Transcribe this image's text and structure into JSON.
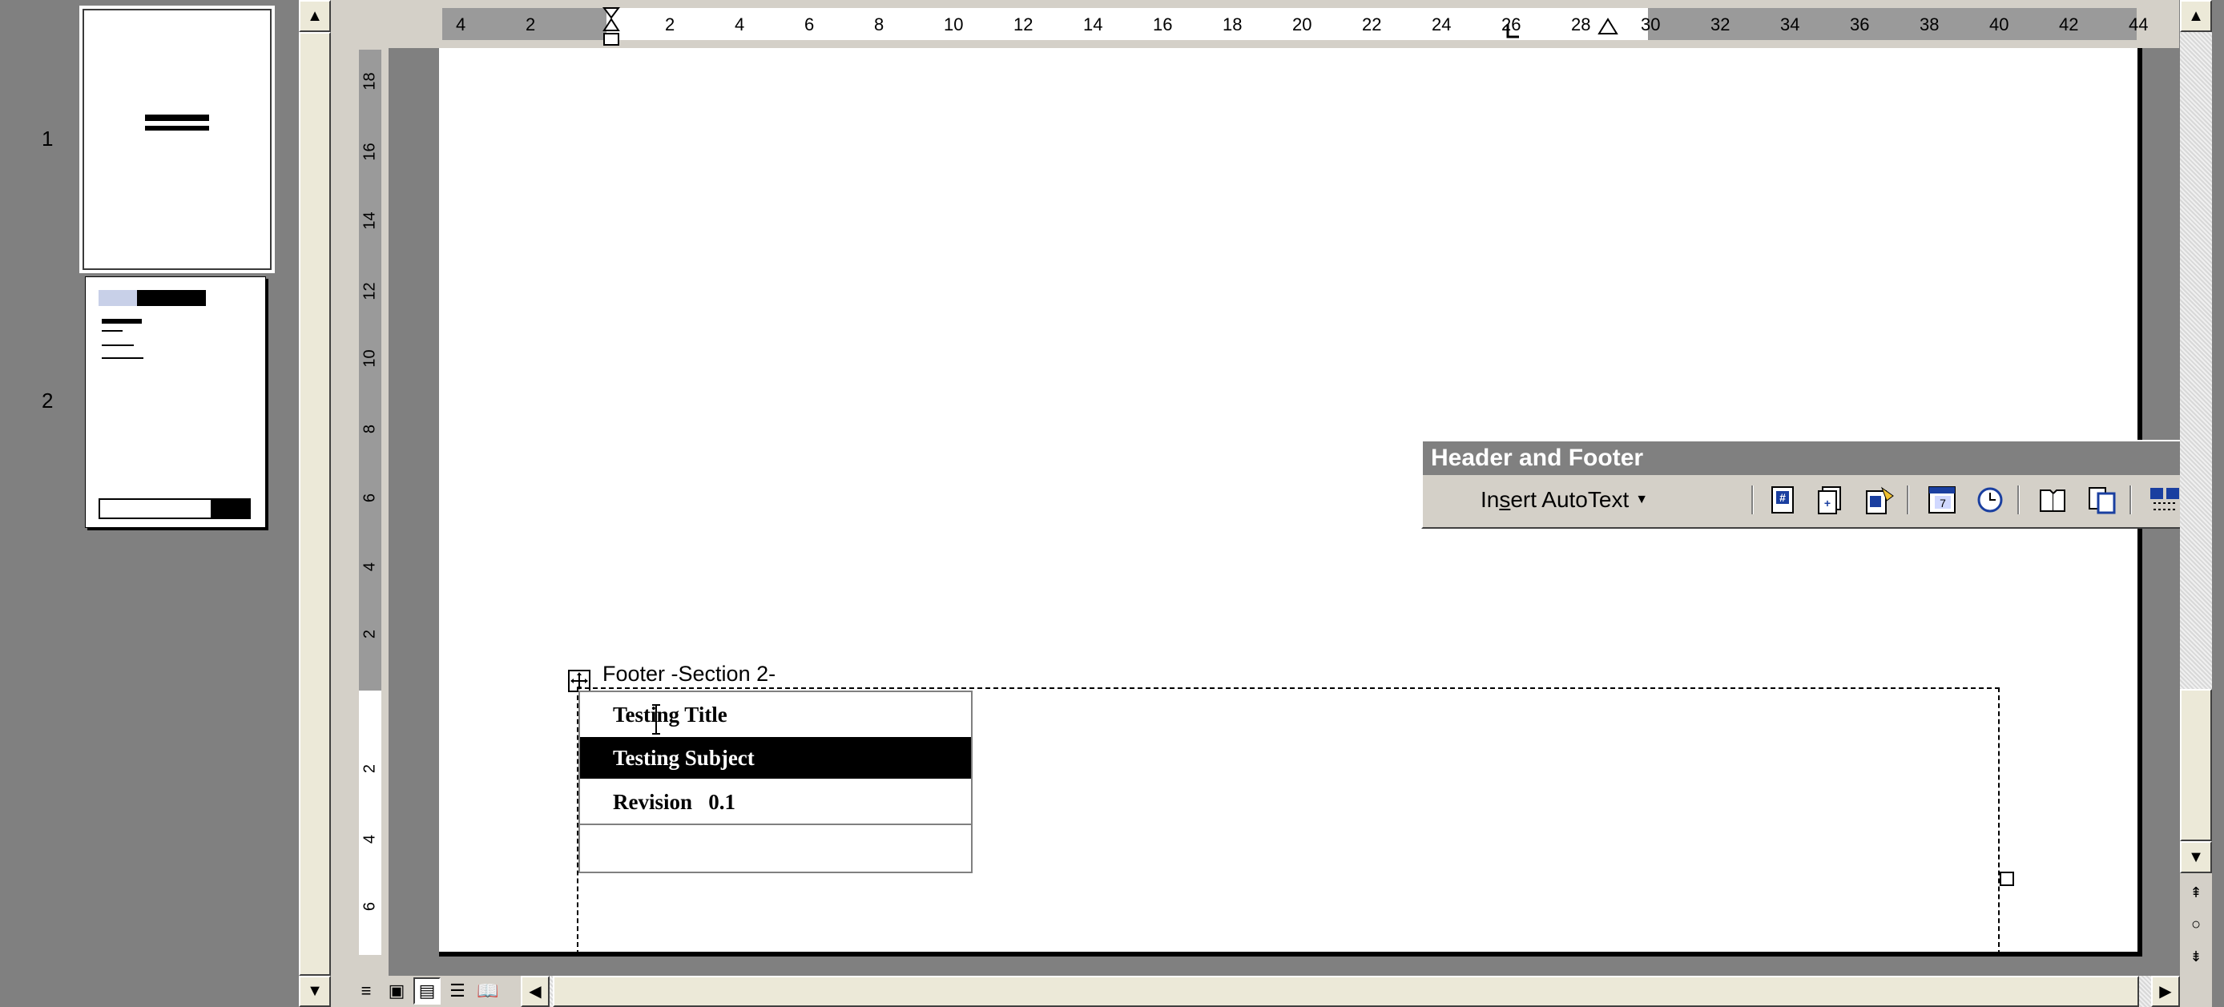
{
  "thumbnails": {
    "pages": [
      {
        "number": "1"
      },
      {
        "number": "2"
      }
    ]
  },
  "ruler": {
    "corner_label": "L",
    "h_ticks": [
      "4",
      "2",
      "2",
      "4",
      "6",
      "8",
      "10",
      "12",
      "14",
      "16",
      "18",
      "20",
      "22",
      "24",
      "26",
      "28",
      "30",
      "32",
      "34",
      "36",
      "38",
      "40",
      "42",
      "44"
    ],
    "v_ticks": [
      "18",
      "16",
      "14",
      "12",
      "10",
      "8",
      "6",
      "4",
      "2",
      "2",
      "4",
      "6"
    ]
  },
  "footer": {
    "label": "Footer -Section 2-",
    "rows": [
      {
        "text": "Testing Title",
        "selected": false
      },
      {
        "text": "Testing Subject",
        "selected": true
      },
      {
        "text": "Revision   0.1",
        "selected": false
      },
      {
        "text": "",
        "selected": false
      }
    ]
  },
  "toolbar": {
    "title": "Header and Footer",
    "insert_autotext_label": "Insert AutoText",
    "insert_autotext_accesskey_char": "s",
    "icons": [
      "insert-page-number-icon",
      "insert-number-of-pages-icon",
      "format-page-number-icon",
      "insert-date-icon",
      "insert-time-icon",
      "page-setup-icon",
      "show-hide-document-text-icon",
      "link-to-previous-icon",
      "switch-header-footer-icon"
    ]
  },
  "colors": {
    "selection_bg": "#000000",
    "selection_text": "#ffffff",
    "workspace_gray": "#808080",
    "chrome": "#d4d0c8"
  }
}
